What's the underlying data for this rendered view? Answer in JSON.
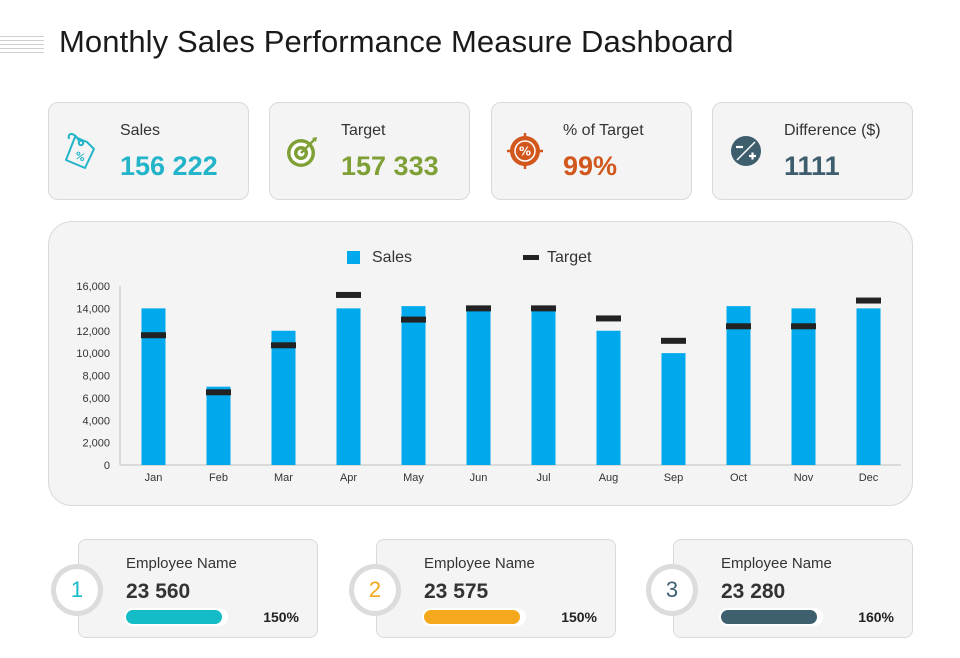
{
  "title": "Monthly Sales Performance Measure Dashboard",
  "kpis": [
    {
      "label": "Sales",
      "value": "156 222",
      "color": "#23b4c9",
      "icon": "price-tag-icon"
    },
    {
      "label": "Target",
      "value": "157 333",
      "color": "#7fa036",
      "icon": "target-icon"
    },
    {
      "label": "% of Target",
      "value": "99%",
      "color": "#d2571d",
      "icon": "percent-target-icon"
    },
    {
      "label": "Difference ($)",
      "value": "1111",
      "color": "#3e5e6e",
      "icon": "plus-minus-icon"
    }
  ],
  "legend": {
    "sales": "Sales",
    "target": "Target"
  },
  "chart_data": {
    "type": "bar",
    "categories": [
      "Jan",
      "Feb",
      "Mar",
      "Apr",
      "May",
      "Jun",
      "Jul",
      "Aug",
      "Sep",
      "Oct",
      "Nov",
      "Dec"
    ],
    "series": [
      {
        "name": "Sales",
        "type": "bar",
        "color": "#00a9ec",
        "values": [
          14000,
          7000,
          12000,
          14000,
          14200,
          14000,
          14000,
          12000,
          10000,
          14200,
          14000,
          14000
        ]
      },
      {
        "name": "Target",
        "type": "marker",
        "color": "#222222",
        "values": [
          11600,
          6500,
          10700,
          15200,
          13000,
          14000,
          14000,
          13100,
          11100,
          12400,
          12400,
          14700
        ]
      }
    ],
    "ylim": [
      0,
      16000
    ],
    "yticks": [
      "0",
      "2,000",
      "4,000",
      "6,000",
      "8,000",
      "10,000",
      "12,000",
      "14,000",
      "16,000"
    ],
    "legend_position": "top-center",
    "grid": false
  },
  "employees": [
    {
      "rank": "1",
      "name": "Employee Name",
      "value": "23 560",
      "percent": "150%",
      "color": "#14bcc8",
      "fill": 0.96
    },
    {
      "rank": "2",
      "name": "Employee Name",
      "value": "23 575",
      "percent": "150%",
      "color": "#f5a81c",
      "fill": 0.96
    },
    {
      "rank": "3",
      "name": "Employee Name",
      "value": "23 280",
      "percent": "160%",
      "color": "#3d5f6e",
      "fill": 0.96
    }
  ]
}
